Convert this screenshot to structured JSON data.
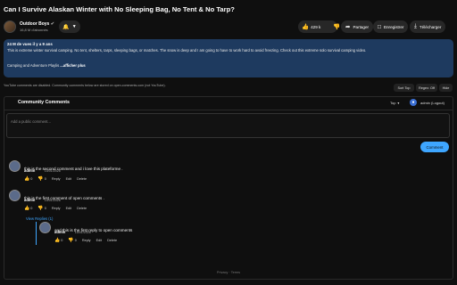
{
  "video": {
    "title": "Can I Survive Alaskan Winter with No Sleeping Bag, No Tent & No Tarp?"
  },
  "channel": {
    "name": "Outdoor Boys",
    "verified_icon": "check-circle-icon",
    "subscribers": "16,8 M d'abonnés",
    "bell_icon": "bell-icon"
  },
  "actions": {
    "likes": "429 k",
    "share_label": "Partager",
    "save_label": "Enregistrer",
    "download_label": "Télécharger"
  },
  "description": {
    "meta": "24 M de vues  il y a 9 ans",
    "body": "This is extreme winter survival camping. No tent, shelters, tarps, sleeping bags, or matches. The snow is deep and I am going to have to work hard to avoid freezing. Check out this extreme solo survival camping video.",
    "tags": "Camping and Adventure Playlis",
    "more_label": "...afficher plus"
  },
  "toolbar": {
    "notice": "YouTube comments are disabled. Community comments below are stored on open-comments.com (not YouTube).",
    "sort_label": "Sort Top",
    "regex_label": "Regex: Off",
    "hide_label": "Hide"
  },
  "community": {
    "title": "Community Comments",
    "sort_value": "Top",
    "user": "admin",
    "logout_label": "(Logout)",
    "placeholder": "Add a public comment...",
    "submit_label": "Comment"
  },
  "comments": [
    {
      "author": "admin",
      "time": "15/01/2026",
      "text": "this is the second comment and i love this plateforme .",
      "likes": "0",
      "dislikes": "0",
      "reply_label": "Reply",
      "edit_label": "Edit",
      "delete_label": "Delete"
    },
    {
      "author": "admin",
      "time": "15/01/2026",
      "text": "this is the first comment of open comments .",
      "likes": "0",
      "dislikes": "0",
      "reply_label": "Reply",
      "edit_label": "Edit",
      "delete_label": "Delete",
      "view_replies_label": "View Replies (1)",
      "replies": [
        {
          "author": "admin",
          "time": "15/01/2026",
          "text": "and this is the first reply to open comments",
          "likes": "0",
          "dislikes": "0",
          "reply_label": "Reply",
          "edit_label": "Edit",
          "delete_label": "Delete"
        }
      ]
    }
  ],
  "footer": {
    "text": "Privacy · Terms"
  }
}
